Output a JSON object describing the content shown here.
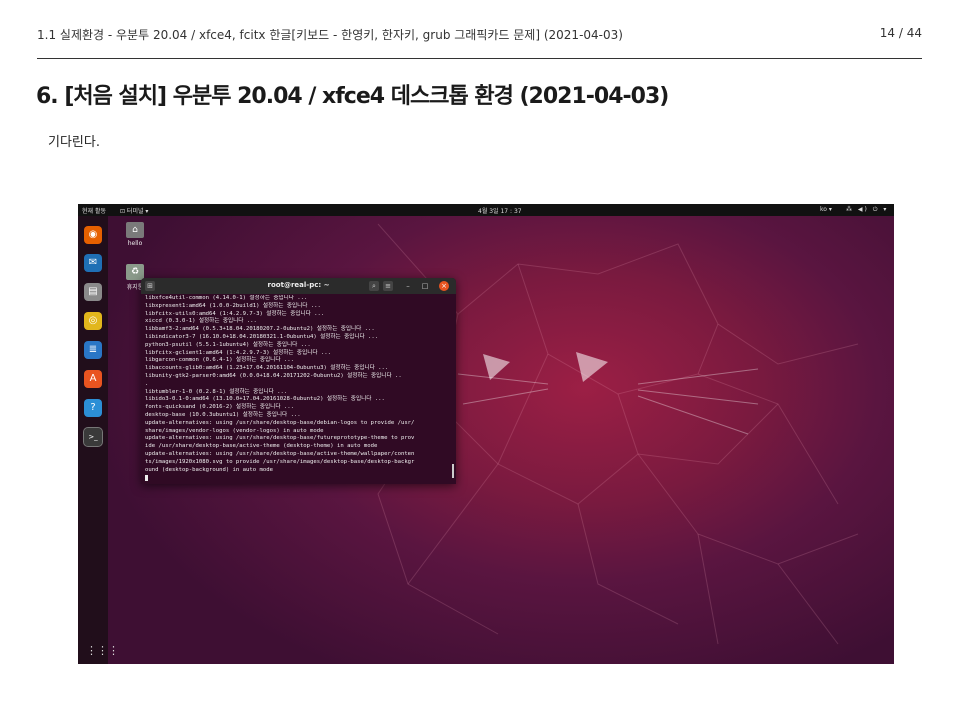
{
  "header": {
    "title": "1.1 실제환경 - 우분투 20.04 / xfce4, fcitx 한글[키보드 - 한영키, 한자키, grub 그래픽카드 문제] (2021-04-03)",
    "page": "14 / 44"
  },
  "slide": {
    "title": "6. [처음 설치] 우분투 20.04 / xfce4 데스크톱 환경 (2021-04-03)",
    "body": "기다린다."
  },
  "desktop": {
    "topbar": {
      "activities": "현재 활동",
      "app": "⊡ 터미널 ▾",
      "clock": "4월 3일  17 : 37",
      "lang": "ko ▾",
      "tray": "⁂ ◀) ⏻ ▾"
    },
    "dock": [
      {
        "name": "firefox-icon",
        "glyph": "◉",
        "color": "#e66000"
      },
      {
        "name": "thunderbird-icon",
        "glyph": "✉",
        "color": "#1f6fb5"
      },
      {
        "name": "files-icon",
        "glyph": "▤",
        "color": "#8a8a8a"
      },
      {
        "name": "rhythmbox-icon",
        "glyph": "◎",
        "color": "#e2b71c"
      },
      {
        "name": "libreoffice-writer-icon",
        "glyph": "≣",
        "color": "#2a76c6"
      },
      {
        "name": "software-center-icon",
        "glyph": "A",
        "color": "#e95420"
      },
      {
        "name": "help-icon",
        "glyph": "?",
        "color": "#2c8fd6"
      },
      {
        "name": "terminal-icon",
        "glyph": ">_",
        "color": "#3a3a3a"
      }
    ],
    "dock_apps_glyph": "⋮⋮⋮",
    "icons": [
      {
        "label": "hello",
        "glyph": "⌂",
        "color": "#7a7a7a"
      },
      {
        "label": "휴지통",
        "glyph": "♻",
        "color": "#8a9a8a"
      }
    ]
  },
  "terminal": {
    "title": "root@real-pc: ~",
    "lines": [
      "libxfce4util-common (4.14.0-1) 설정하는 중입니다 ...",
      "libxpresent1:amd64 (1.0.0-2build1) 설정하는 중입니다 ...",
      "libfcitx-utils0:amd64 (1:4.2.9.7-3) 설정하는 중입니다 ...",
      "xiccd (0.3.0-1) 설정하는 중입니다 ...",
      "libbamf3-2:amd64 (0.5.3+18.04.20180207.2-0ubuntu2) 설정하는 중입니다 ...",
      "libindicator3-7 (16.10.0+18.04.20180321.1-0ubuntu4) 설정하는 중입니다 ...",
      "python3-psutil (5.5.1-1ubuntu4) 설정하는 중입니다 ...",
      "libfcitx-gclient1:amd64 (1:4.2.9.7-3) 설정하는 중입니다 ...",
      "libgarcon-common (0.6.4-1) 설정하는 중입니다 ...",
      "libaccounts-glib0:amd64 (1.23+17.04.20161104-0ubuntu3) 설정하는 중입니다 ...",
      "libunity-gtk2-parser0:amd64 (0.0.0+18.04.20171202-0ubuntu2) 설정하는 중입니다 ..",
      ".",
      "libtumbler-1-0 (0.2.8-1) 설정하는 중입니다 ...",
      "libido3-0.1-0:amd64 (13.10.0+17.04.20161028-0ubuntu2) 설정하는 중입니다 ...",
      "fonts-quicksand (0.2016-2) 설정하는 중입니다 ...",
      "desktop-base (10.0.3ubuntu1) 설정하는 중입니다 ...",
      "update-alternatives: using /usr/share/desktop-base/debian-logos to provide /usr/",
      "share/images/vendor-logos (vendor-logos) in auto mode",
      "update-alternatives: using /usr/share/desktop-base/futureprototype-theme to prov",
      "ide /usr/share/desktop-base/active-theme (desktop-theme) in auto mode",
      "update-alternatives: using /usr/share/desktop-base/active-theme/wallpaper/conten",
      "ts/images/1920x1080.svg to provide /usr/share/images/desktop-base/desktop-backgr",
      "ound (desktop-background) in auto mode"
    ]
  }
}
